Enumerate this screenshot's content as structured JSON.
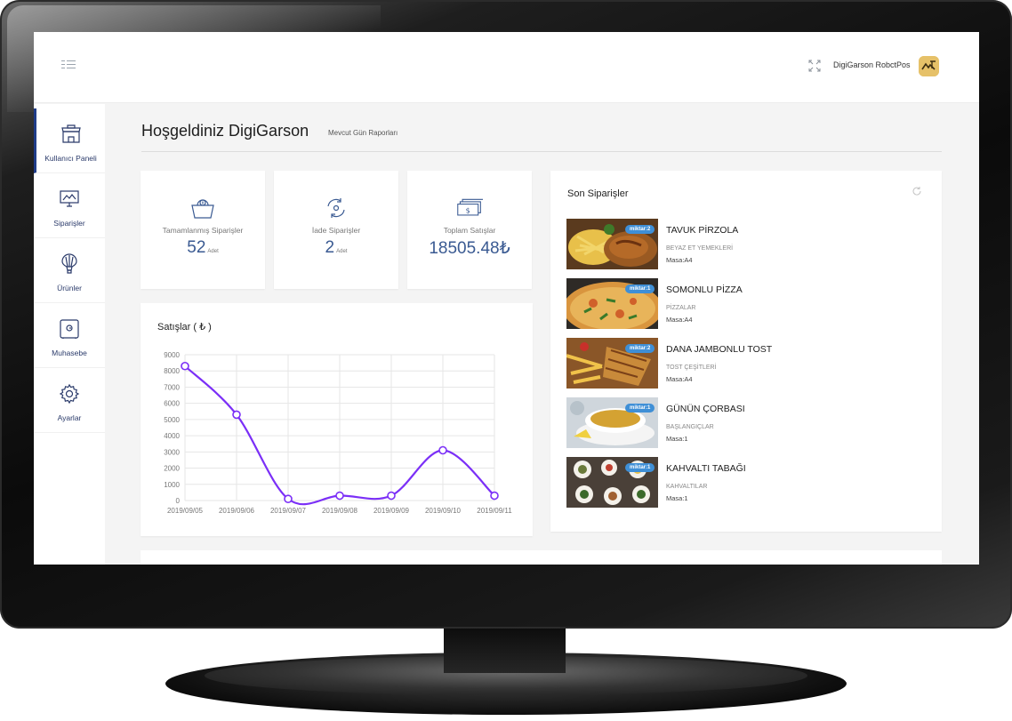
{
  "topbar": {
    "username": "DigiGarson  RobctPos",
    "icons": {
      "menu": "menu-icon",
      "fullscreen": "fullscreen-icon",
      "avatar": "user-avatar"
    }
  },
  "sidebar": {
    "items": [
      {
        "label": "Kullanıcı Paneli",
        "icon": "store-icon",
        "active": true
      },
      {
        "label": "Siparişler",
        "icon": "monitor-icon",
        "active": false
      },
      {
        "label": "Ürünler",
        "icon": "balloon-icon",
        "active": false
      },
      {
        "label": "Muhasebe",
        "icon": "safe-icon",
        "active": false
      },
      {
        "label": "Ayarlar",
        "icon": "gear-icon",
        "active": false
      }
    ]
  },
  "header": {
    "title": "Hoşgeldiniz DigiGarson",
    "subtitle": "Mevcut Gün Raporları"
  },
  "stats": [
    {
      "label": "Tamamlanmış Siparişler",
      "value": "52",
      "unit": "Adet",
      "icon": "basket-icon"
    },
    {
      "label": "İade Siparişler",
      "value": "2",
      "unit": "Adet",
      "icon": "refund-icon"
    },
    {
      "label": "Toplam Satışlar",
      "value": "18505.48₺",
      "unit": "",
      "icon": "money-icon"
    }
  ],
  "sales_chart": {
    "title": "Satışlar ( ₺ )",
    "chart_data": {
      "type": "line",
      "x": [
        "2019/09/05",
        "2019/09/06",
        "2019/09/07",
        "2019/09/08",
        "2019/09/09",
        "2019/09/10",
        "2019/09/11"
      ],
      "series": [
        {
          "values": [
            8300,
            5300,
            100,
            300,
            300,
            3100,
            300
          ]
        }
      ],
      "ylim": [
        0,
        9000
      ],
      "yticks": [
        0,
        1000,
        2000,
        3000,
        4000,
        5000,
        6000,
        7000,
        8000,
        9000
      ],
      "grid": true,
      "line_color": "#7b2ff7"
    }
  },
  "orders": {
    "title": "Son Siparişler",
    "items": [
      {
        "badge": "miktar:2",
        "name": "TAVUK PİRZOLA",
        "category": "BEYAZ ET YEMEKLERİ",
        "table": "Masa:A4",
        "image": "grilled-chicken-photo"
      },
      {
        "badge": "miktar:1",
        "name": "SOMONLU PİZZA",
        "category": "PİZZALAR",
        "table": "Masa:A4",
        "image": "pizza-photo"
      },
      {
        "badge": "miktar:2",
        "name": "DANA JAMBONLU TOST",
        "category": "TOST ÇEŞİTLERİ",
        "table": "Masa:A4",
        "image": "toast-photo"
      },
      {
        "badge": "miktar:1",
        "name": "GÜNÜN ÇORBASI",
        "category": "BAŞLANGIÇLAR",
        "table": "Masa:1",
        "image": "soup-photo"
      },
      {
        "badge": "miktar:1",
        "name": "KAHVALTI TABAĞI",
        "category": "KAHVALTILAR",
        "table": "Masa:1",
        "image": "breakfast-photo"
      }
    ]
  },
  "colors": {
    "accent": "#3a5a92",
    "badge": "#3f8fd6",
    "line": "#7b2ff7",
    "avatar": "#e6c169"
  }
}
